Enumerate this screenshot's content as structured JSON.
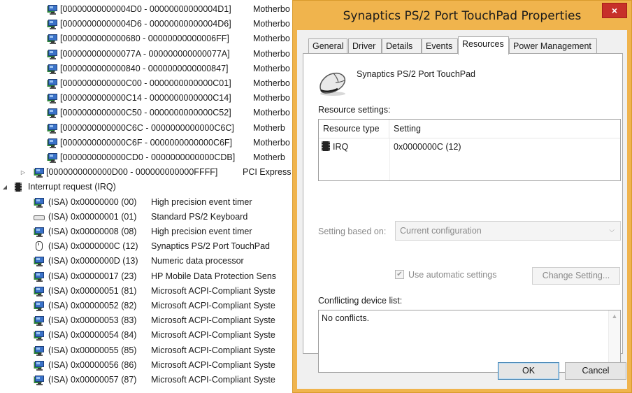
{
  "tree": {
    "memory_rows": [
      {
        "range": "[00000000000004D0 - 00000000000004D1]",
        "desc": "Motherbo"
      },
      {
        "range": "[00000000000004D6 - 00000000000004D6]",
        "desc": "Motherbo"
      },
      {
        "range": "[0000000000000680 - 00000000000006FF]",
        "desc": "Motherbo"
      },
      {
        "range": "[000000000000077A - 000000000000077A]",
        "desc": "Motherbo"
      },
      {
        "range": "[0000000000000840 - 0000000000000847]",
        "desc": "Motherbo"
      },
      {
        "range": "[0000000000000C00 - 0000000000000C01]",
        "desc": "Motherbo"
      },
      {
        "range": "[0000000000000C14 - 0000000000000C14]",
        "desc": "Motherbo"
      },
      {
        "range": "[0000000000000C50 - 0000000000000C52]",
        "desc": "Motherbo"
      },
      {
        "range": "[0000000000000C6C - 0000000000000C6C]",
        "desc": "Motherb"
      },
      {
        "range": "[0000000000000C6F - 0000000000000C6F]",
        "desc": "Motherbo"
      },
      {
        "range": "[0000000000000CD0 - 0000000000000CDB]",
        "desc": "Motherb"
      }
    ],
    "pci_row": {
      "range": "[0000000000000D00 - 000000000000FFFF]",
      "desc": "PCI Express Ro"
    },
    "irq_header": "Interrupt request (IRQ)",
    "irq_rows": [
      {
        "irq": "(ISA) 0x00000000 (00)",
        "device": "High precision event timer",
        "icon": "monitor-icon"
      },
      {
        "irq": "(ISA) 0x00000001 (01)",
        "device": "Standard PS/2 Keyboard",
        "icon": "keyboard-icon"
      },
      {
        "irq": "(ISA) 0x00000008 (08)",
        "device": "High precision event timer",
        "icon": "monitor-icon"
      },
      {
        "irq": "(ISA) 0x0000000C (12)",
        "device": "Synaptics PS/2 Port TouchPad",
        "icon": "mouse-icon"
      },
      {
        "irq": "(ISA) 0x0000000D (13)",
        "device": "Numeric data processor",
        "icon": "monitor-icon"
      },
      {
        "irq": "(ISA) 0x00000017 (23)",
        "device": "HP Mobile Data Protection Sens",
        "icon": "monitor-icon"
      },
      {
        "irq": "(ISA) 0x00000051 (81)",
        "device": "Microsoft ACPI-Compliant Syste",
        "icon": "monitor-icon"
      },
      {
        "irq": "(ISA) 0x00000052 (82)",
        "device": "Microsoft ACPI-Compliant Syste",
        "icon": "monitor-icon"
      },
      {
        "irq": "(ISA) 0x00000053 (83)",
        "device": "Microsoft ACPI-Compliant Syste",
        "icon": "monitor-icon"
      },
      {
        "irq": "(ISA) 0x00000054 (84)",
        "device": "Microsoft ACPI-Compliant Syste",
        "icon": "monitor-icon"
      },
      {
        "irq": "(ISA) 0x00000055 (85)",
        "device": "Microsoft ACPI-Compliant Syste",
        "icon": "monitor-icon"
      },
      {
        "irq": "(ISA) 0x00000056 (86)",
        "device": "Microsoft ACPI-Compliant Syste",
        "icon": "monitor-icon"
      },
      {
        "irq": "(ISA) 0x00000057 (87)",
        "device": "Microsoft ACPI-Compliant Syste",
        "icon": "monitor-icon"
      }
    ]
  },
  "dialog": {
    "title": "Synaptics PS/2 Port TouchPad Properties",
    "close_glyph": "×",
    "tabs": [
      {
        "label": "General",
        "active": false
      },
      {
        "label": "Driver",
        "active": false
      },
      {
        "label": "Details",
        "active": false
      },
      {
        "label": "Events",
        "active": false
      },
      {
        "label": "Resources",
        "active": true
      },
      {
        "label": "Power Management",
        "active": false
      }
    ],
    "device_name": "Synaptics PS/2 Port TouchPad",
    "resource_settings_label": "Resource settings:",
    "resource_columns": {
      "type": "Resource type",
      "setting": "Setting"
    },
    "resource_rows": [
      {
        "type": "IRQ",
        "setting": "0x0000000C (12)"
      }
    ],
    "setting_based_on_label": "Setting based on:",
    "setting_based_on_value": "Current configuration",
    "use_automatic_label": "Use automatic settings",
    "use_automatic_checked": true,
    "change_setting_label": "Change Setting...",
    "conflicting_label": "Conflicting device list:",
    "conflicting_text": "No conflicts.",
    "ok_label": "OK",
    "cancel_label": "Cancel"
  },
  "colors": {
    "title_bar": "#f0b44d",
    "close_button": "#c7302a"
  }
}
